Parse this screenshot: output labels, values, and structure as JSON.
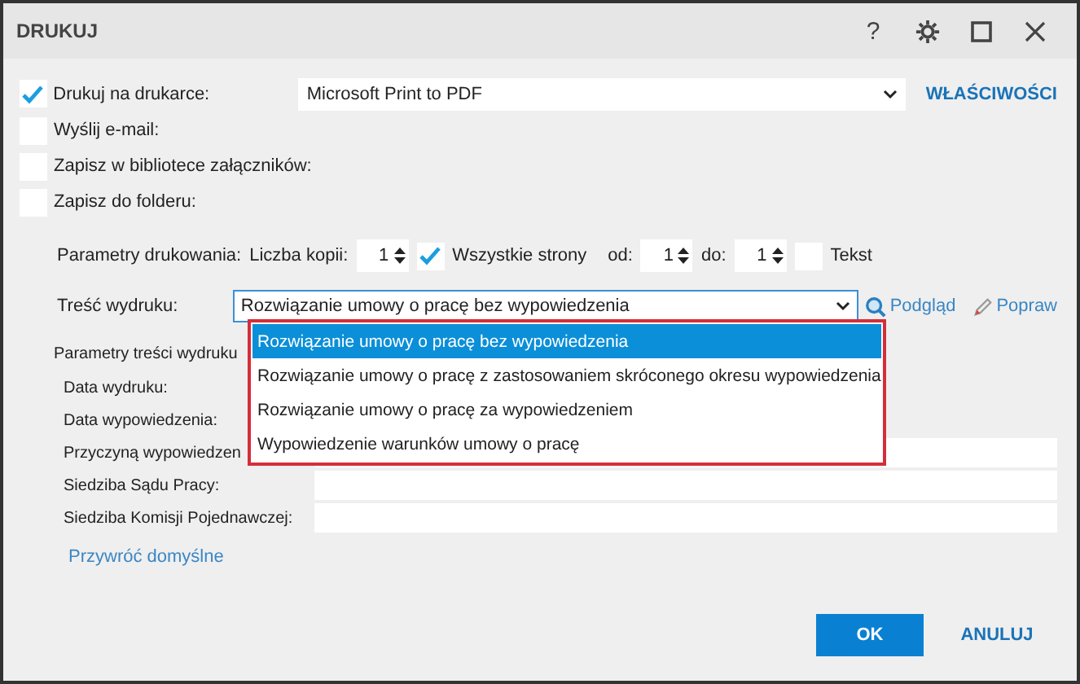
{
  "window": {
    "title": "DRUKUJ",
    "controls": [
      "?"
    ]
  },
  "outputs": [
    {
      "label": "Drukuj na drukarce:",
      "checked": true
    },
    {
      "label": "Wyślij e-mail:",
      "checked": false
    },
    {
      "label": "Zapisz w bibliotece załączników:",
      "checked": false
    },
    {
      "label": "Zapisz do folderu:",
      "checked": false
    }
  ],
  "printer": {
    "value": "Microsoft Print to PDF",
    "properties_link": "WŁAŚCIWOŚCI"
  },
  "print_params": {
    "label": "Parametry drukowania:",
    "copies_label": "Liczba kopii:",
    "copies": "1",
    "all_pages": {
      "label": "Wszystkie strony",
      "checked": true
    },
    "from_label": "od:",
    "from": "1",
    "to_label": "do:",
    "to": "1",
    "text": {
      "label": "Tekst",
      "checked": false
    }
  },
  "content": {
    "label": "Treść wydruku:",
    "value": "Rozwiązanie umowy o pracę bez wypowiedzenia",
    "preview": "Podgląd",
    "edit": "Popraw",
    "options": [
      {
        "label": "Rozwiązanie umowy o pracę bez wypowiedzenia",
        "selected": true
      },
      {
        "label": "Rozwiązanie umowy o pracę z zastosowaniem skróconego okresu wypowiedzenia",
        "selected": false
      },
      {
        "label": "Rozwiązanie umowy o pracę za wypowiedzeniem",
        "selected": false
      },
      {
        "label": "Wypowiedzenie warunków umowy o pracę",
        "selected": false
      }
    ]
  },
  "content_params": {
    "label": "Parametry treści wydruku",
    "fields": [
      {
        "label": "Data wydruku:",
        "kind": "hidden"
      },
      {
        "label": "Data wypowiedzenia:",
        "kind": "hidden"
      },
      {
        "label": "Przyczyną wypowiedzen",
        "kind": "text"
      },
      {
        "label": "Siedziba Sądu Pracy:",
        "kind": "text"
      },
      {
        "label": "Siedziba Komisji Pojednawczej:",
        "kind": "text"
      }
    ],
    "restore_link": "Przywróć domyślne"
  },
  "buttons": {
    "ok": "OK",
    "cancel": "ANULUJ"
  }
}
